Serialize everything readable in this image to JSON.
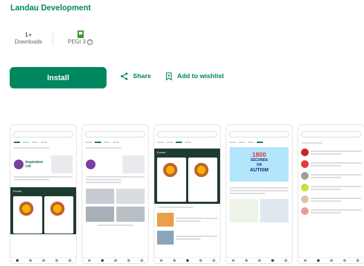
{
  "developer": "Landau Development",
  "stats": {
    "downloads_value": "1+",
    "downloads_label": "Downloads",
    "rating_label": "PEGI 3",
    "rating_info": "i"
  },
  "actions": {
    "install": "Install",
    "share": "Share",
    "wishlist": "Add to wishlist"
  },
  "colors": {
    "accent": "#01875f",
    "install_bg": "#01875f"
  },
  "icons": {
    "share": "share-icon",
    "wishlist": "bookmark-add-icon",
    "info": "info-icon",
    "pegi": "pegi-badge-icon"
  },
  "screenshots": {
    "poster_line1": "1800",
    "poster_line2": "SECONDS",
    "poster_line3": "ON",
    "poster_line4": "AUTISM",
    "shot1_logo": "Inspiration Ltd",
    "shot1_panel": "Events",
    "shot3_panel": "Events"
  }
}
